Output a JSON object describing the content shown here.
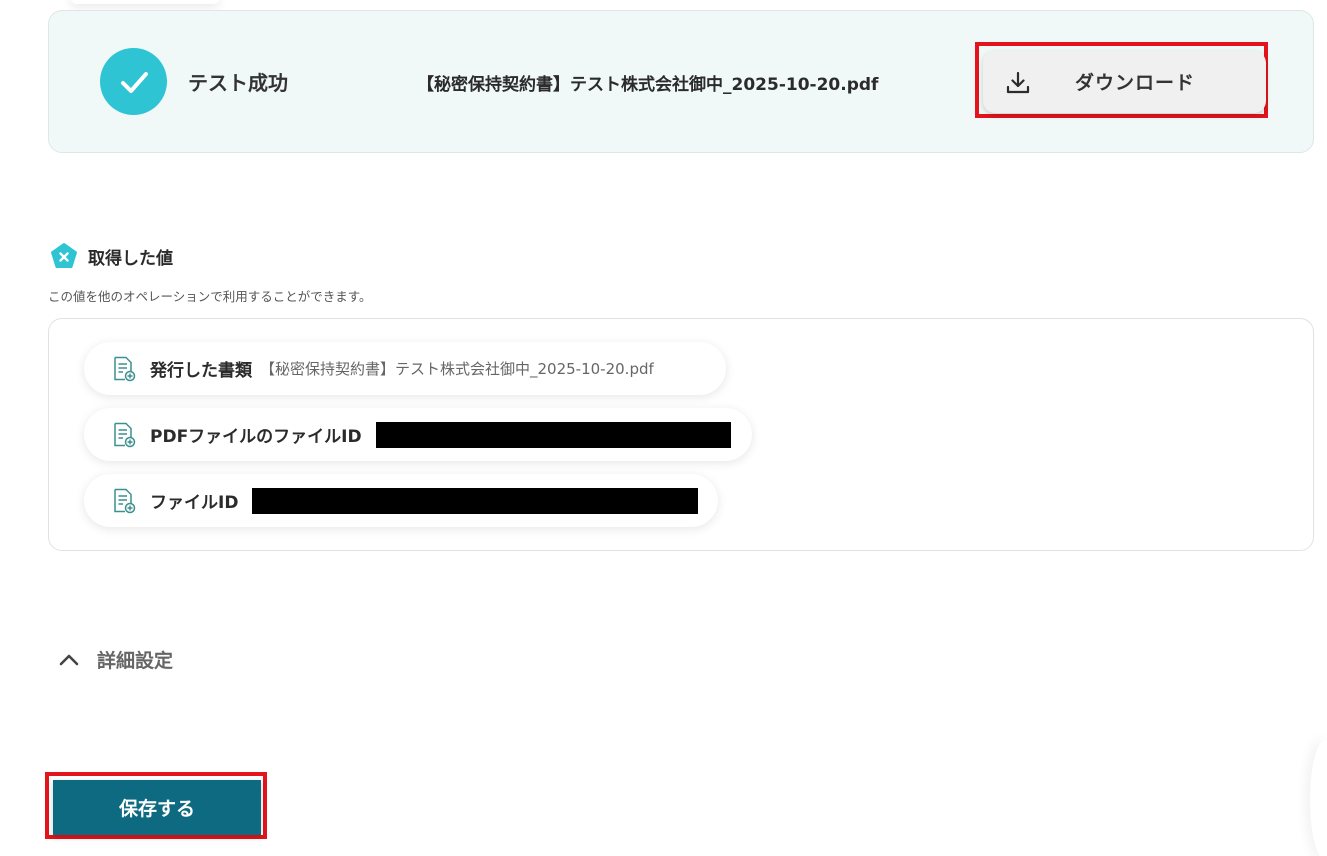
{
  "test_result": {
    "status_label": "テスト成功",
    "filename": "【秘密保持契約書】テスト株式会社御中_2025-10-20.pdf",
    "download_label": "ダウンロード"
  },
  "acquired_values": {
    "title": "取得した値",
    "description": "この値を他のオペレーションで利用することができます。",
    "items": [
      {
        "label": "発行した書類",
        "value": "【秘密保持契約書】テスト株式会社御中_2025-10-20.pdf"
      },
      {
        "label": "PDFファイルのファイルID",
        "value": ""
      },
      {
        "label": "ファイルID",
        "value": ""
      }
    ]
  },
  "details": {
    "label": "詳細設定"
  },
  "save": {
    "label": "保存する"
  },
  "colors": {
    "accent": "#0e6a80",
    "success": "#2ec4d4",
    "highlight": "#e3141b",
    "card_bg": "#f1f9f8"
  },
  "icons": {
    "status": "check-circle-icon",
    "download": "download-icon",
    "values": "variable-icon",
    "item": "document-icon",
    "details": "chevron-up-icon"
  }
}
